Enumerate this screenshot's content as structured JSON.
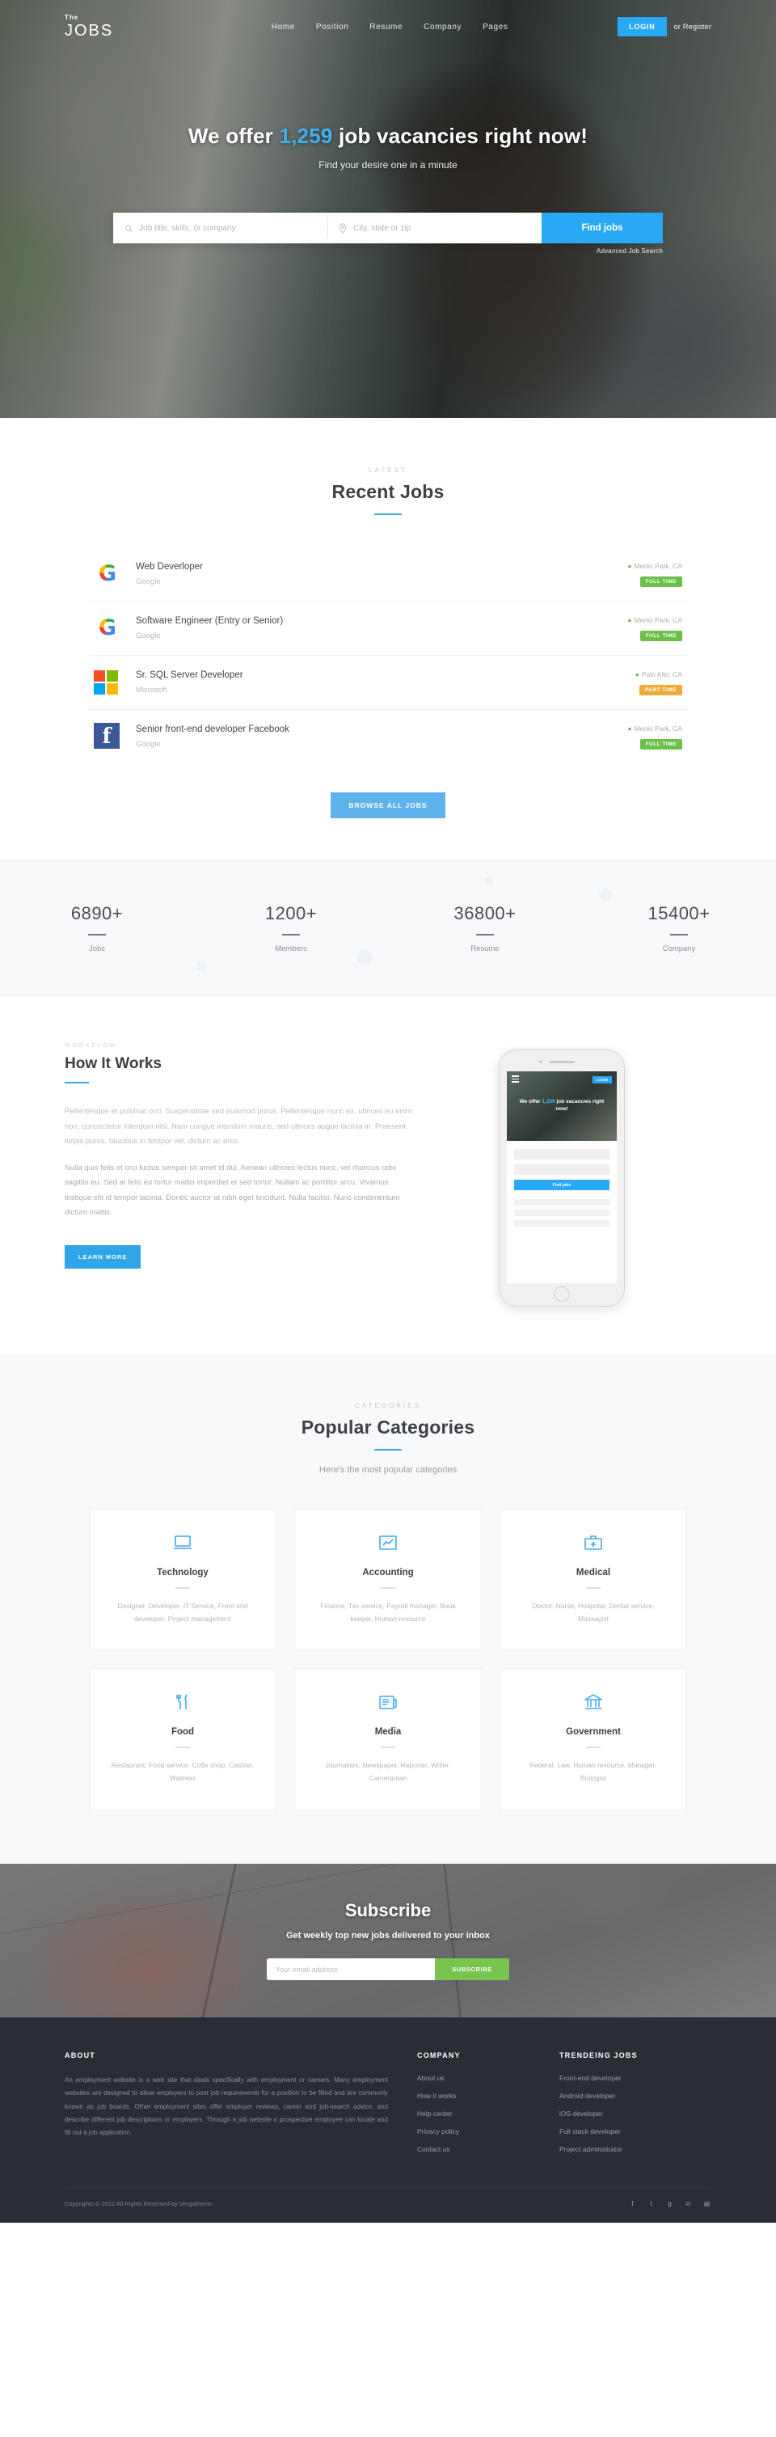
{
  "brand": {
    "pre": "The",
    "name": "JOBS"
  },
  "colors": {
    "accent": "#29a9f5",
    "green": "#6cc04a",
    "orange": "#eeab36",
    "subscribe_green": "#78c44e",
    "footer_bg": "#2a2d33"
  },
  "nav": {
    "items": [
      {
        "label": "Home"
      },
      {
        "label": "Position"
      },
      {
        "label": "Resume"
      },
      {
        "label": "Company"
      },
      {
        "label": "Pages"
      }
    ],
    "login_label": "LOGIN",
    "register_label": "or Register"
  },
  "hero": {
    "title_pre": "We offer",
    "title_count": "1,259",
    "title_post": "job vacancies right now!",
    "subtitle": "Find your desire one in a minute",
    "search": {
      "keyword_placeholder": "Job title, skills, or company",
      "keyword_value": "",
      "location_placeholder": "City, state or zip",
      "location_value": "",
      "button_label": "Find jobs",
      "advanced_label": "Advanced Job Search",
      "search_icon": "search-icon",
      "location_icon": "map-pin-icon"
    }
  },
  "recent": {
    "kicker": "LATEST",
    "title": "Recent Jobs",
    "browse_label": "BROWSE ALL JOBS",
    "jobs": [
      {
        "title": "Web Deverloper",
        "company": "Google",
        "location": "Menlo Park, CA",
        "badge": "FULL TIME",
        "badge_type": "full",
        "logo": "google-logo"
      },
      {
        "title": "Software Engineer (Entry or Senior)",
        "company": "Google",
        "location": "Menlo Park, CA",
        "badge": "FULL TIME",
        "badge_type": "full",
        "logo": "google-logo"
      },
      {
        "title": "Sr. SQL Server Developer",
        "company": "Microsoft",
        "location": "Palo Alto, CA",
        "badge": "PART TIME",
        "badge_type": "part",
        "logo": "microsoft-logo"
      },
      {
        "title": "Senior front-end developer Facebook",
        "company": "Google",
        "location": "Menlo Park, CA",
        "badge": "FULL TIME",
        "badge_type": "full",
        "logo": "facebook-logo"
      }
    ]
  },
  "stats": [
    {
      "number": "6890+",
      "label": "Jobs"
    },
    {
      "number": "1200+",
      "label": "Members"
    },
    {
      "number": "36800+",
      "label": "Resume"
    },
    {
      "number": "15400+",
      "label": "Company"
    }
  ],
  "how": {
    "kicker": "WORKFLOW",
    "title": "How It Works",
    "paragraph1": "Pellentesque et pulvinar orci. Suspendisse sed euismod purus. Pellentesque nunc ex, ultrices eu enim non, consectetur interdum nisl. Nam congue interdum mauris, sed ultrices augue lacinia in. Praesent turpis purus, faucibus in tempor vel, dictum ac eros.",
    "paragraph2": "Nulla quis felis et orci luctus semper sit amet id dui. Aenean ultricies lectus nunc, vel rhoncus odio sagittis eu. Sed at felis eu tortor mattis imperdiet et sed tortor. Nullam ac porttitor arcu. Vivamus tristique elit id tempor lacinia. Donec auctor at nibh eget tincidunt. Nulla facilisi. Nunc condimentum dictum mattis.",
    "button_label": "LEARN MORE",
    "phone": {
      "title_pre": "We offer",
      "title_count": "1,259",
      "title_post": "job vacancies right now!",
      "login_label": "LOGIN",
      "button_label": "Find jobs"
    }
  },
  "categories": {
    "kicker": "CATEGORIES",
    "title": "Popular Categories",
    "description": "Here's the most popular categories",
    "items": [
      {
        "name": "Technology",
        "icon": "laptop-icon",
        "description": "Designer, Developer, IT Service, Front-end developer, Project management"
      },
      {
        "name": "Accounting",
        "icon": "chart-line-icon",
        "description": "Finance, Tax service, Payroll manager, Book keeper, Human resource"
      },
      {
        "name": "Medical",
        "icon": "medical-briefcase-icon",
        "description": "Doctor, Nurse, Hospotal, Dental service, Massagist"
      },
      {
        "name": "Food",
        "icon": "utensils-icon",
        "description": "Restaurant, Food service, Coffe shop, Cashier, Waitress"
      },
      {
        "name": "Media",
        "icon": "newspaper-icon",
        "description": "Journalism, Newspaper, Reporter, Writer, Cameraman"
      },
      {
        "name": "Government",
        "icon": "bank-icon",
        "description": "Federal, Law, Human resource, Manager, Biologist"
      }
    ]
  },
  "subscribe": {
    "title": "Subscribe",
    "description": "Get weekly top new jobs delivered to your inbox",
    "email_placeholder": "Your email address",
    "email_value": "",
    "button_label": "SUBSCRIBE"
  },
  "footer": {
    "about": {
      "heading": "ABOUT",
      "text": "An employment website is a web site that deals specifically with employment or careers. Many employment websites are designed to allow employers to post job requirements for a position to be filled and are commonly known as job boards. Other employment sites offer employer reviews, career and job-search advice, and describe different job descriptions or employers. Through a job website a prospective employee can locate and fill out a job application."
    },
    "company": {
      "heading": "COMPANY",
      "links": [
        {
          "label": "About us"
        },
        {
          "label": "How it works"
        },
        {
          "label": "Help center"
        },
        {
          "label": "Privacy policy"
        },
        {
          "label": "Contact us"
        }
      ]
    },
    "trending": {
      "heading": "TRENDEING JOBS",
      "links": [
        {
          "label": "Front-end developer"
        },
        {
          "label": "Android developer"
        },
        {
          "label": "iOS developer"
        },
        {
          "label": "Full stack developer"
        },
        {
          "label": "Project administrator"
        }
      ]
    },
    "copyright": "Copyrights © 2022 All Rights Reserved by Vergatheme.",
    "socials": [
      {
        "name": "facebook-icon",
        "glyph": "f"
      },
      {
        "name": "twitter-icon",
        "glyph": "t"
      },
      {
        "name": "google-plus-icon",
        "glyph": "g"
      },
      {
        "name": "linkedin-icon",
        "glyph": "in"
      },
      {
        "name": "rss-icon",
        "glyph": "▤"
      }
    ]
  }
}
